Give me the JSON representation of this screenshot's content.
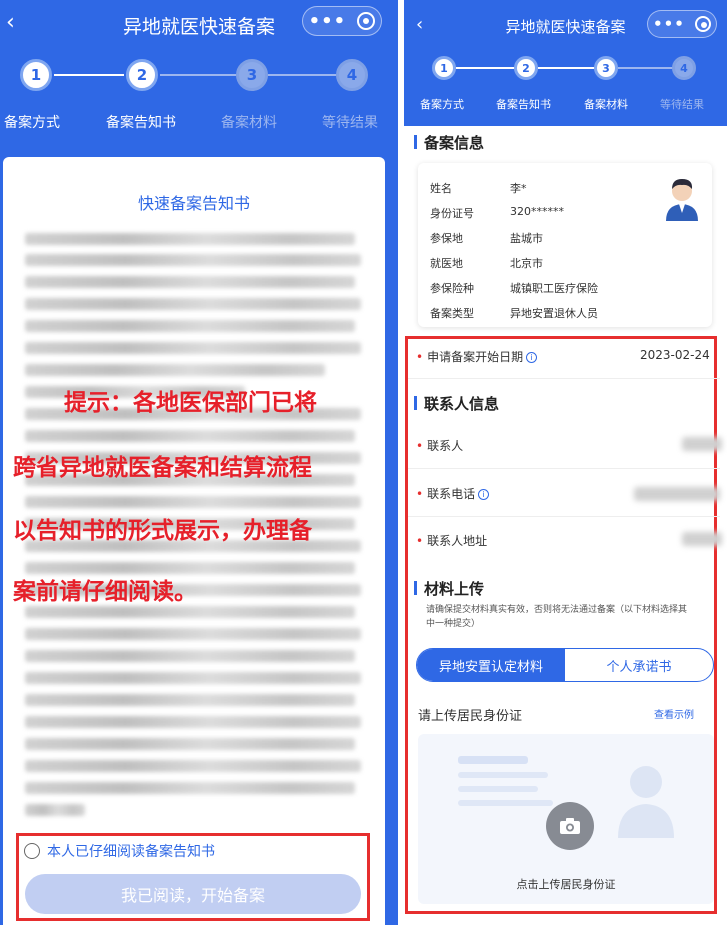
{
  "left": {
    "title": "异地就医快速备案",
    "back": "‹",
    "steps": [
      {
        "num": "1",
        "label": "备案方式",
        "active": true
      },
      {
        "num": "2",
        "label": "备案告知书",
        "active": true
      },
      {
        "num": "3",
        "label": "备案材料",
        "active": false
      },
      {
        "num": "4",
        "label": "等待结果",
        "active": false
      }
    ],
    "card_title": "快速备案告知书",
    "overlay": [
      "提示：各地医保部门已将",
      "跨省异地就医备案和结算流程",
      "以告知书的形式展示，办理备",
      "案前请仔细阅读。"
    ],
    "agree_label": "本人已仔细阅读备案告知书",
    "read_button": "我已阅读，开始备案"
  },
  "right": {
    "title": "异地就医快速备案",
    "back": "‹",
    "steps": [
      {
        "num": "1",
        "label": "备案方式",
        "active": true
      },
      {
        "num": "2",
        "label": "备案告知书",
        "active": true
      },
      {
        "num": "3",
        "label": "备案材料",
        "active": true
      },
      {
        "num": "4",
        "label": "等待结果",
        "active": false
      }
    ],
    "info_title": "备案信息",
    "info": [
      {
        "k": "姓名",
        "v": "李*"
      },
      {
        "k": "身份证号",
        "v": "320******"
      },
      {
        "k": "参保地",
        "v": "盐城市"
      },
      {
        "k": "就医地",
        "v": "北京市"
      },
      {
        "k": "参保险种",
        "v": "城镇职工医疗保险"
      },
      {
        "k": "备案类型",
        "v": "异地安置退休人员"
      }
    ],
    "start_date_label": "申请备案开始日期",
    "start_date_value": "2023-02-24",
    "contact_title": "联系人信息",
    "contact_fields": [
      "联系人",
      "联系电话",
      "联系人地址"
    ],
    "material_title": "材料上传",
    "material_note_1": "请确保提交材料真实有效，否则将无法通过备案（以下材料选择其",
    "material_note_2": "中一种提交）",
    "tabs": [
      "异地安置认定材料",
      "个人承诺书"
    ],
    "upload_label": "请上传居民身份证",
    "view_example": "查看示例",
    "upload_hint": "点击上传居民身份证"
  },
  "colors": {
    "accent": "#2f68e5",
    "highlight": "#e62e2e"
  }
}
